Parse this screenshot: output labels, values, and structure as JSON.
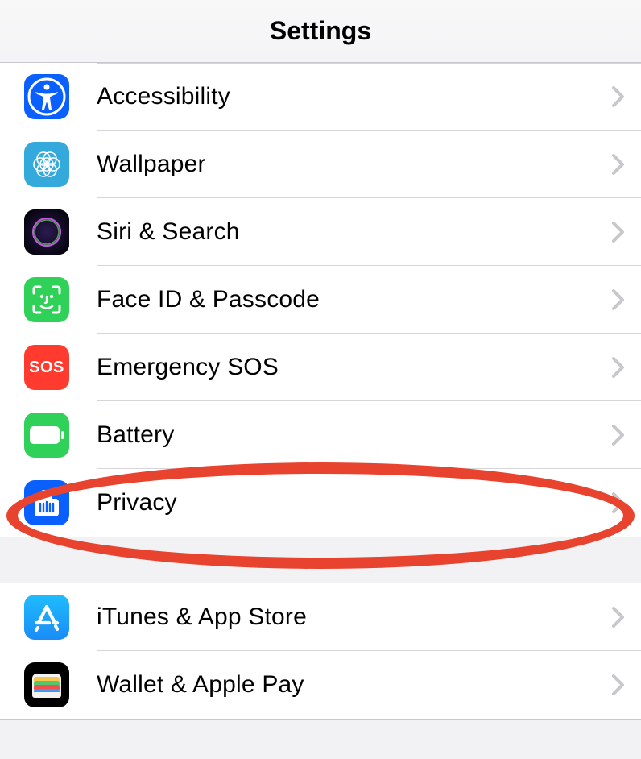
{
  "header": {
    "title": "Settings"
  },
  "group1": {
    "items": [
      {
        "label": "Accessibility",
        "icon": "accessibility-icon"
      },
      {
        "label": "Wallpaper",
        "icon": "wallpaper-icon"
      },
      {
        "label": "Siri & Search",
        "icon": "siri-icon"
      },
      {
        "label": "Face ID & Passcode",
        "icon": "faceid-icon"
      },
      {
        "label": "Emergency SOS",
        "icon": "sos-icon"
      },
      {
        "label": "Battery",
        "icon": "battery-icon"
      },
      {
        "label": "Privacy",
        "icon": "privacy-icon"
      }
    ]
  },
  "group2": {
    "items": [
      {
        "label": "iTunes & App Store",
        "icon": "appstore-icon"
      },
      {
        "label": "Wallet & Apple Pay",
        "icon": "wallet-icon"
      }
    ]
  },
  "annotation": {
    "target_item": "Privacy",
    "style": "red-ellipse"
  }
}
